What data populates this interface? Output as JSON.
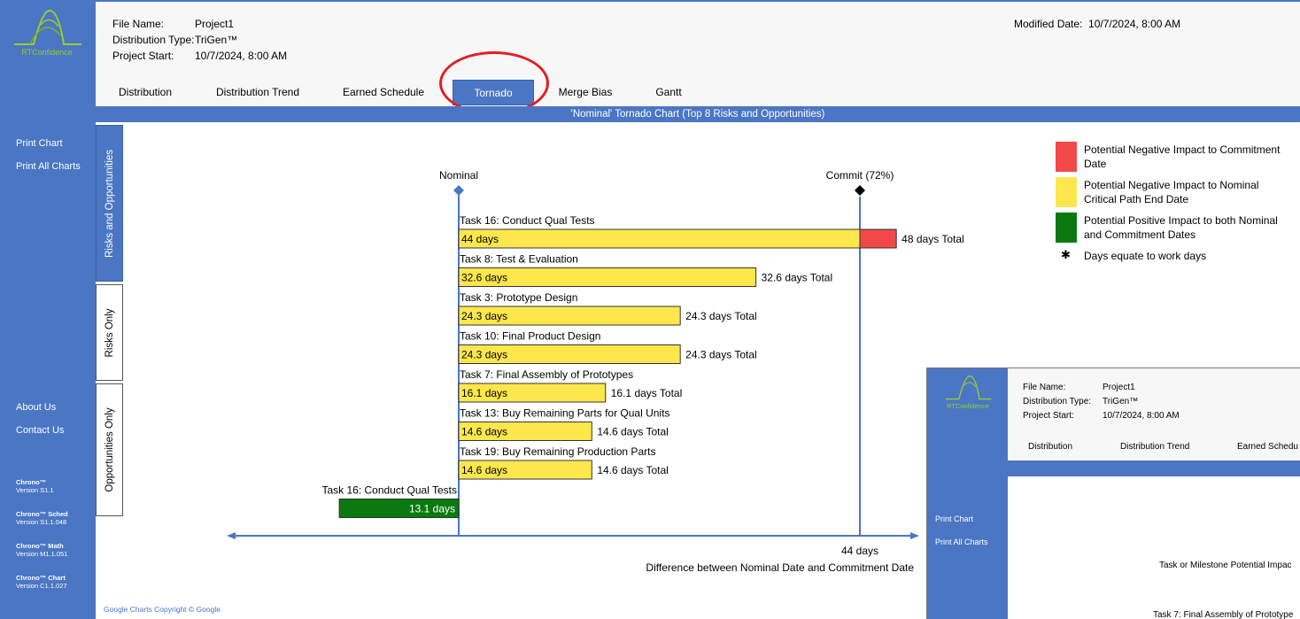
{
  "app": {
    "logo_text": "RTConfidence"
  },
  "header": {
    "file_name_label": "File Name:",
    "file_name": "Project1",
    "dist_label": "Distribution Type:",
    "dist_value": "TriGen™",
    "start_label": "Project Start:",
    "start_value": "10/7/2024, 8:00 AM",
    "modified_label": "Modified Date:",
    "modified_value": "10/7/2024, 8:00 AM"
  },
  "tabs": [
    "Distribution",
    "Distribution Trend",
    "Earned Schedule",
    "Tornado",
    "Merge Bias",
    "Gantt"
  ],
  "active_tab": "Tornado",
  "title_bar": "'Nominal' Tornado Chart (Top 8 Risks and Opportunities)",
  "sidebar": {
    "print_chart": "Print Chart",
    "print_all": "Print All Charts",
    "about": "About Us",
    "contact": "Contact Us",
    "versions": [
      {
        "name": "Chrono™",
        "version": "Version S1.1"
      },
      {
        "name": "Chrono™ Sched",
        "version": "Version S1.1.048"
      },
      {
        "name": "Chrono™ Math",
        "version": "Version M1.1.051"
      },
      {
        "name": "Chrono™ Chart",
        "version": "Version C1.1.027"
      }
    ]
  },
  "side_tabs": [
    "Risks and Opportunities",
    "Risks Only",
    "Opportunities Only"
  ],
  "legend": {
    "red": "Potential Negative Impact to Commitment Date",
    "yellow": "Potential Negative Impact to Nominal Critical Path End Date",
    "green": "Potential Positive Impact to both Nominal and Commitment Dates",
    "note": "Days equate to work days",
    "colors": {
      "red": "#f24848",
      "yellow": "#fde74c",
      "green": "#0a7a10"
    }
  },
  "copyright": "Google Charts Copyright © Google",
  "chart_data": {
    "type": "bar",
    "unit": "days",
    "markers": [
      {
        "label": "Nominal",
        "value": 0
      },
      {
        "label": "Commit (72%)",
        "value": 44
      }
    ],
    "risks": [
      {
        "task": "Task 16: Conduct Qual Tests",
        "nominal_impact": "44 days",
        "nominal_value": 44,
        "total_value": 48,
        "total_label": "48 days Total"
      },
      {
        "task": "Task 8: Test & Evaluation",
        "nominal_impact": "32.6 days",
        "nominal_value": 32.6,
        "total_value": 32.6,
        "total_label": "32.6 days Total"
      },
      {
        "task": "Task 3: Prototype Design",
        "nominal_impact": "24.3 days",
        "nominal_value": 24.3,
        "total_value": 24.3,
        "total_label": "24.3 days Total"
      },
      {
        "task": "Task 10: Final Product Design",
        "nominal_impact": "24.3 days",
        "nominal_value": 24.3,
        "total_value": 24.3,
        "total_label": "24.3 days Total"
      },
      {
        "task": "Task 7: Final Assembly of Prototypes",
        "nominal_impact": "16.1 days",
        "nominal_value": 16.1,
        "total_value": 16.1,
        "total_label": "16.1 days Total"
      },
      {
        "task": "Task 13: Buy Remaining Parts for Qual Units",
        "nominal_impact": "14.6 days",
        "nominal_value": 14.6,
        "total_value": 14.6,
        "total_label": "14.6 days Total"
      },
      {
        "task": "Task 19: Buy Remaining Production Parts",
        "nominal_impact": "14.6 days",
        "nominal_value": 14.6,
        "total_value": 14.6,
        "total_label": "14.6 days Total"
      }
    ],
    "opportunities": [
      {
        "task": "Task 16: Conduct Qual Tests",
        "impact": "13.1 days",
        "value": -13.1
      }
    ],
    "axis": {
      "value_label": "44 days",
      "caption": "Difference between Nominal Date and Commitment Date"
    }
  },
  "second_window": {
    "logo_text": "RTConfidence",
    "file_name_label": "File Name:",
    "file_name": "Project1",
    "dist_label": "Distribution Type:",
    "dist_value": "TriGen™",
    "start_label": "Project Start:",
    "start_value": "10/7/2024, 8:00 AM",
    "tabs": [
      "Distribution",
      "Distribution Trend",
      "Earned Schedu"
    ],
    "print_chart": "Print Chart",
    "print_all": "Print All Charts",
    "text1": "Task or Milestone Potential Impac",
    "text2": "Task 7: Final Assembly of Prototype"
  }
}
